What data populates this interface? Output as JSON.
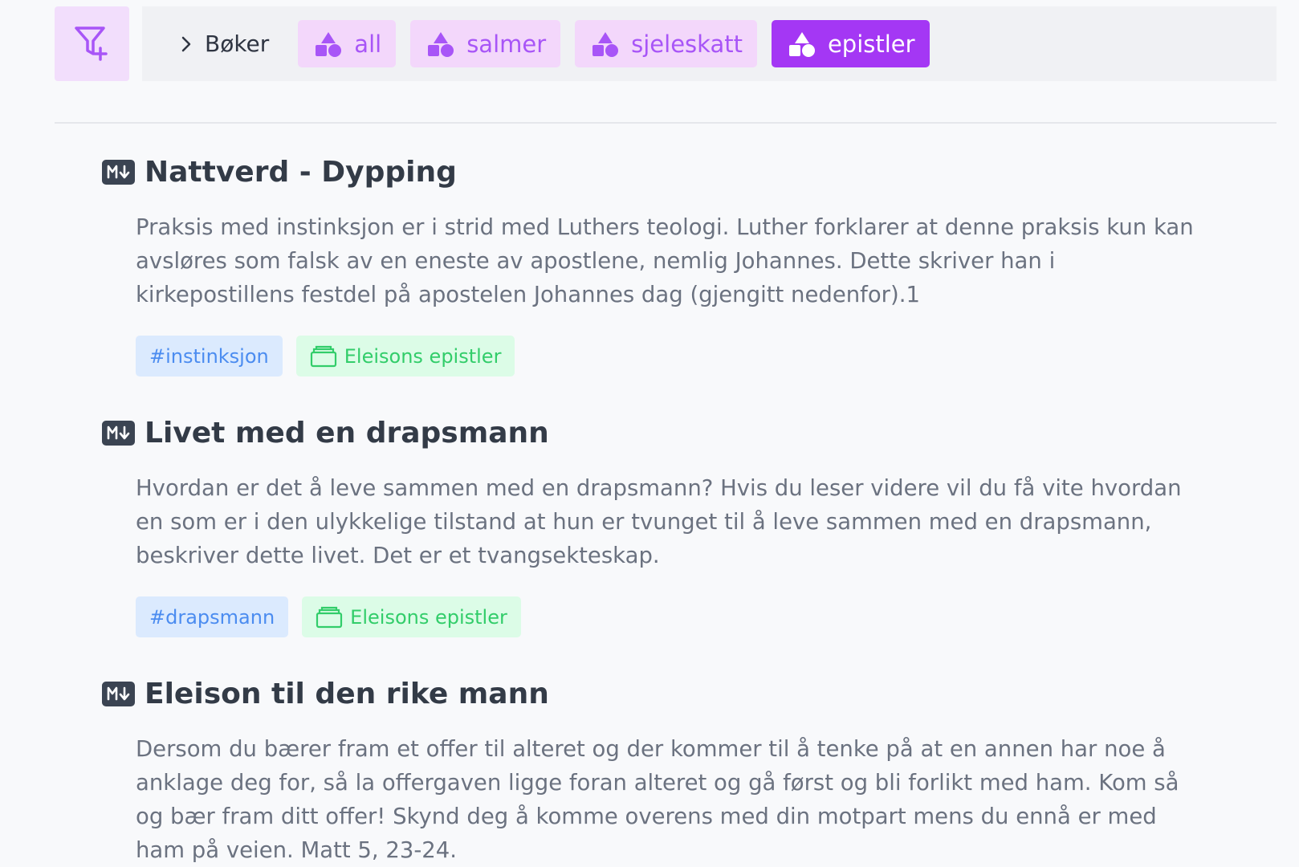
{
  "colors": {
    "accent_purple": "#a437f4",
    "chip_bg": "#f3d7fb",
    "chip_text": "#a855f7",
    "hash_tag_bg": "#dbeafe",
    "hash_tag_text": "#4b8cf0",
    "folder_tag_bg": "#dcfce7",
    "folder_tag_text": "#32cd6a"
  },
  "toolbar": {
    "filter_icon": "filter-plus-icon",
    "breadcrumb": {
      "icon": "chevron-right-icon",
      "label": "Bøker"
    },
    "chips": [
      {
        "icon": "shapes-icon",
        "label": "all",
        "active": false
      },
      {
        "icon": "shapes-icon",
        "label": "salmer",
        "active": false
      },
      {
        "icon": "shapes-icon",
        "label": "sjeleskatt",
        "active": false
      },
      {
        "icon": "shapes-icon",
        "label": "epistler",
        "active": true
      }
    ]
  },
  "notes": [
    {
      "icon": "markdown-icon",
      "title": "Nattverd - Dypping",
      "excerpt": "Praksis med instinksjon er i strid med Luthers teologi. Luther forklarer at denne praksis kun kan avsløres som falsk av en eneste av apostlene, nemlig Johannes. Dette skriver han i kirkepostillens festdel på apostelen Johannes dag (gjengitt nedenfor).1",
      "tag": "#instinksjon",
      "folder": "Eleisons epistler"
    },
    {
      "icon": "markdown-icon",
      "title": "Livet med en drapsmann",
      "excerpt": "Hvordan er det å leve sammen med en drapsmann? Hvis du leser videre vil du få vite hvordan en som er i den ulykkelige tilstand at hun er tvunget til å leve sammen med en drapsmann, beskriver dette livet. Det er et tvangsekteskap.",
      "tag": "#drapsmann",
      "folder": "Eleisons epistler"
    },
    {
      "icon": "markdown-icon",
      "title": "Eleison til den rike mann",
      "excerpt": "Dersom du bærer fram et offer til alteret og der kommer til å tenke på at en annen har noe å anklage deg for, så la offergaven ligge foran alteret og gå først og bli forlikt med ham. Kom så og bær fram ditt offer! Skynd deg å komme overens med din motpart mens du ennå er med ham på veien. Matt 5, 23-24."
    }
  ]
}
